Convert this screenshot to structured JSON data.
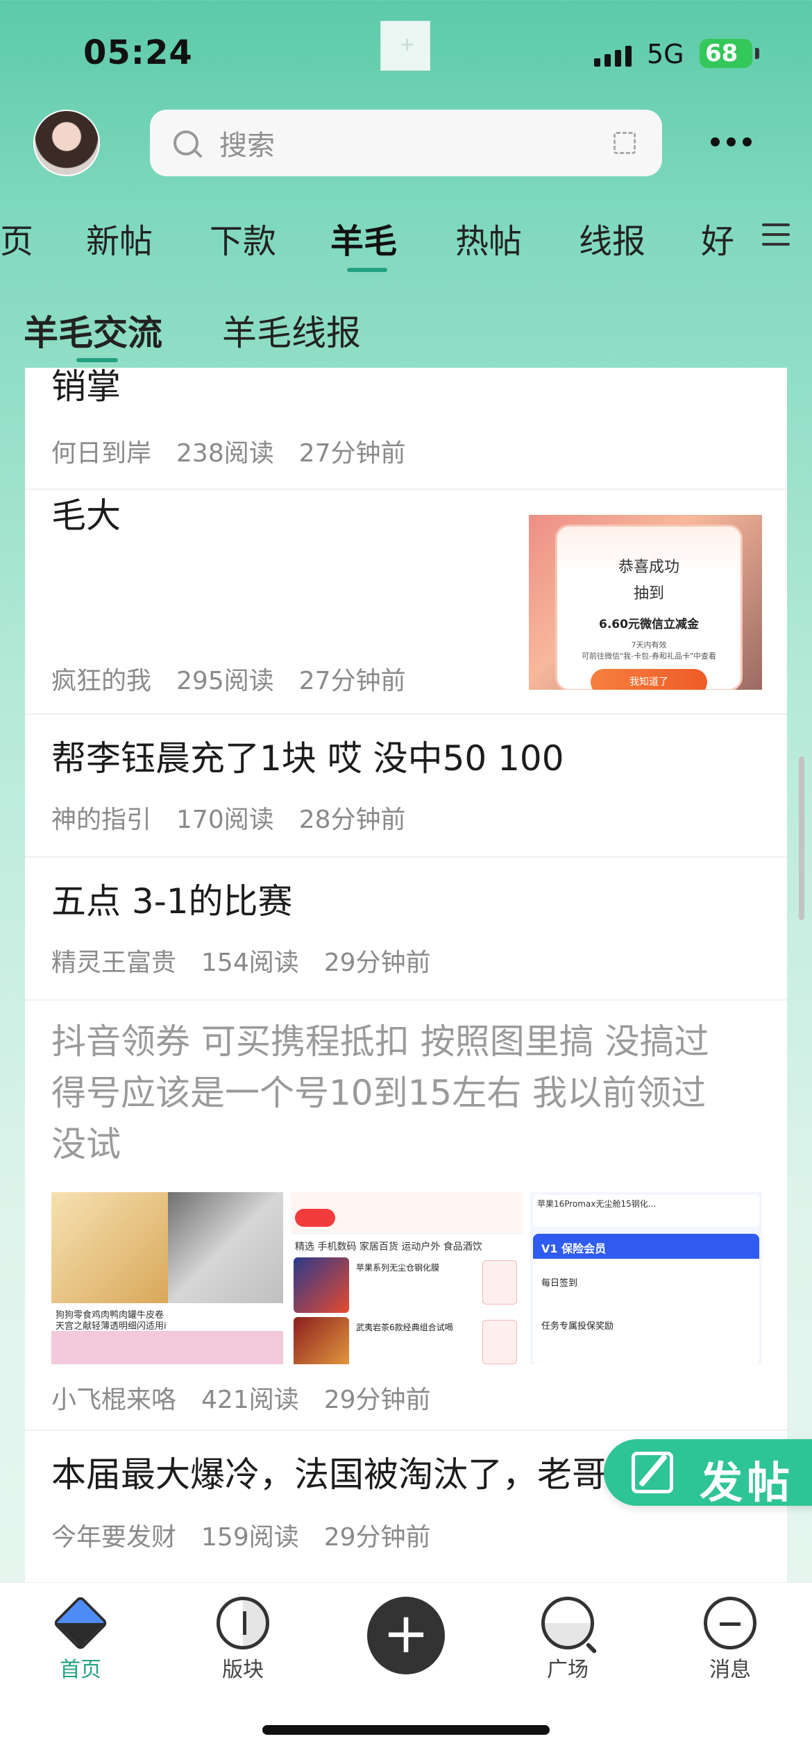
{
  "status_bar": {
    "time": "05:24",
    "network": "5G",
    "battery": "68"
  },
  "header": {
    "search_placeholder": "搜索"
  },
  "tabs": [
    {
      "label": "页"
    },
    {
      "label": "新帖"
    },
    {
      "label": "下款"
    },
    {
      "label": "羊毛"
    },
    {
      "label": "热帖"
    },
    {
      "label": "线报"
    },
    {
      "label": "好"
    }
  ],
  "subtabs": [
    {
      "label": "羊毛交流"
    },
    {
      "label": "羊毛线报"
    }
  ],
  "posts": [
    {
      "title": "销掌",
      "author": "何日到岸",
      "reads": "238阅读",
      "time": "27分钟前"
    },
    {
      "title": "毛大",
      "author": "疯狂的我",
      "reads": "295阅读",
      "time": "27分钟前",
      "image": {
        "line1": "恭喜成功",
        "line2": "抽到",
        "line3": "6.60元微信立减金",
        "line4": "7天内有效",
        "line5": "可前往微信\"我-卡包-券和礼品卡\"中查看",
        "button": "我知道了"
      }
    },
    {
      "title": "帮李钰晨充了1块 哎 没中50 100",
      "author": "神的指引",
      "reads": "170阅读",
      "time": "28分钟前"
    },
    {
      "title": "五点 3-1的比赛",
      "author": "精灵王富贵",
      "reads": "154阅读",
      "time": "29分钟前"
    },
    {
      "title_line1": "抖音领券   可买携程抵扣   按照图里搞   没搞过",
      "title_line2": "得号应该是一个号10到15左右   我以前领过",
      "title_line3": "没试",
      "author": "小飞棍来咯",
      "reads": "421阅读",
      "time": "29分钟前",
      "thumbs": {
        "t1_caption": "狗狗零食鸡肉鸭肉罐牛皮卷",
        "t1_caption2": "天宫之献轻薄透明细闪适用i",
        "t2_tabs": "精选   手机数码   家居百货   运动户外   食品酒饮",
        "t2_item1": "苹果系列无尘仓钢化膜",
        "t2_item2": "武夷岩茶6款经典组合试喝",
        "t3_order": "苹果16Promax无尘舱15钢化...",
        "t3_header": "V1 保险会员",
        "t3_row1": "每日签到",
        "t3_row2": "任务专属投保奖励"
      }
    },
    {
      "title": "本届最大爆冷，法国被淘汰了，老哥",
      "author": "今年要发财",
      "reads": "159阅读",
      "time": "29分钟前"
    }
  ],
  "fab": {
    "label": "发帖"
  },
  "bottom_nav": [
    {
      "label": "首页",
      "icon": "home-icon",
      "active": true
    },
    {
      "label": "版块",
      "icon": "section-icon"
    },
    {
      "label": "广场",
      "icon": "plaza-icon"
    },
    {
      "label": "消息",
      "icon": "message-icon"
    }
  ],
  "colors": {
    "accent": "#23a282",
    "fab": "#2fc495"
  }
}
